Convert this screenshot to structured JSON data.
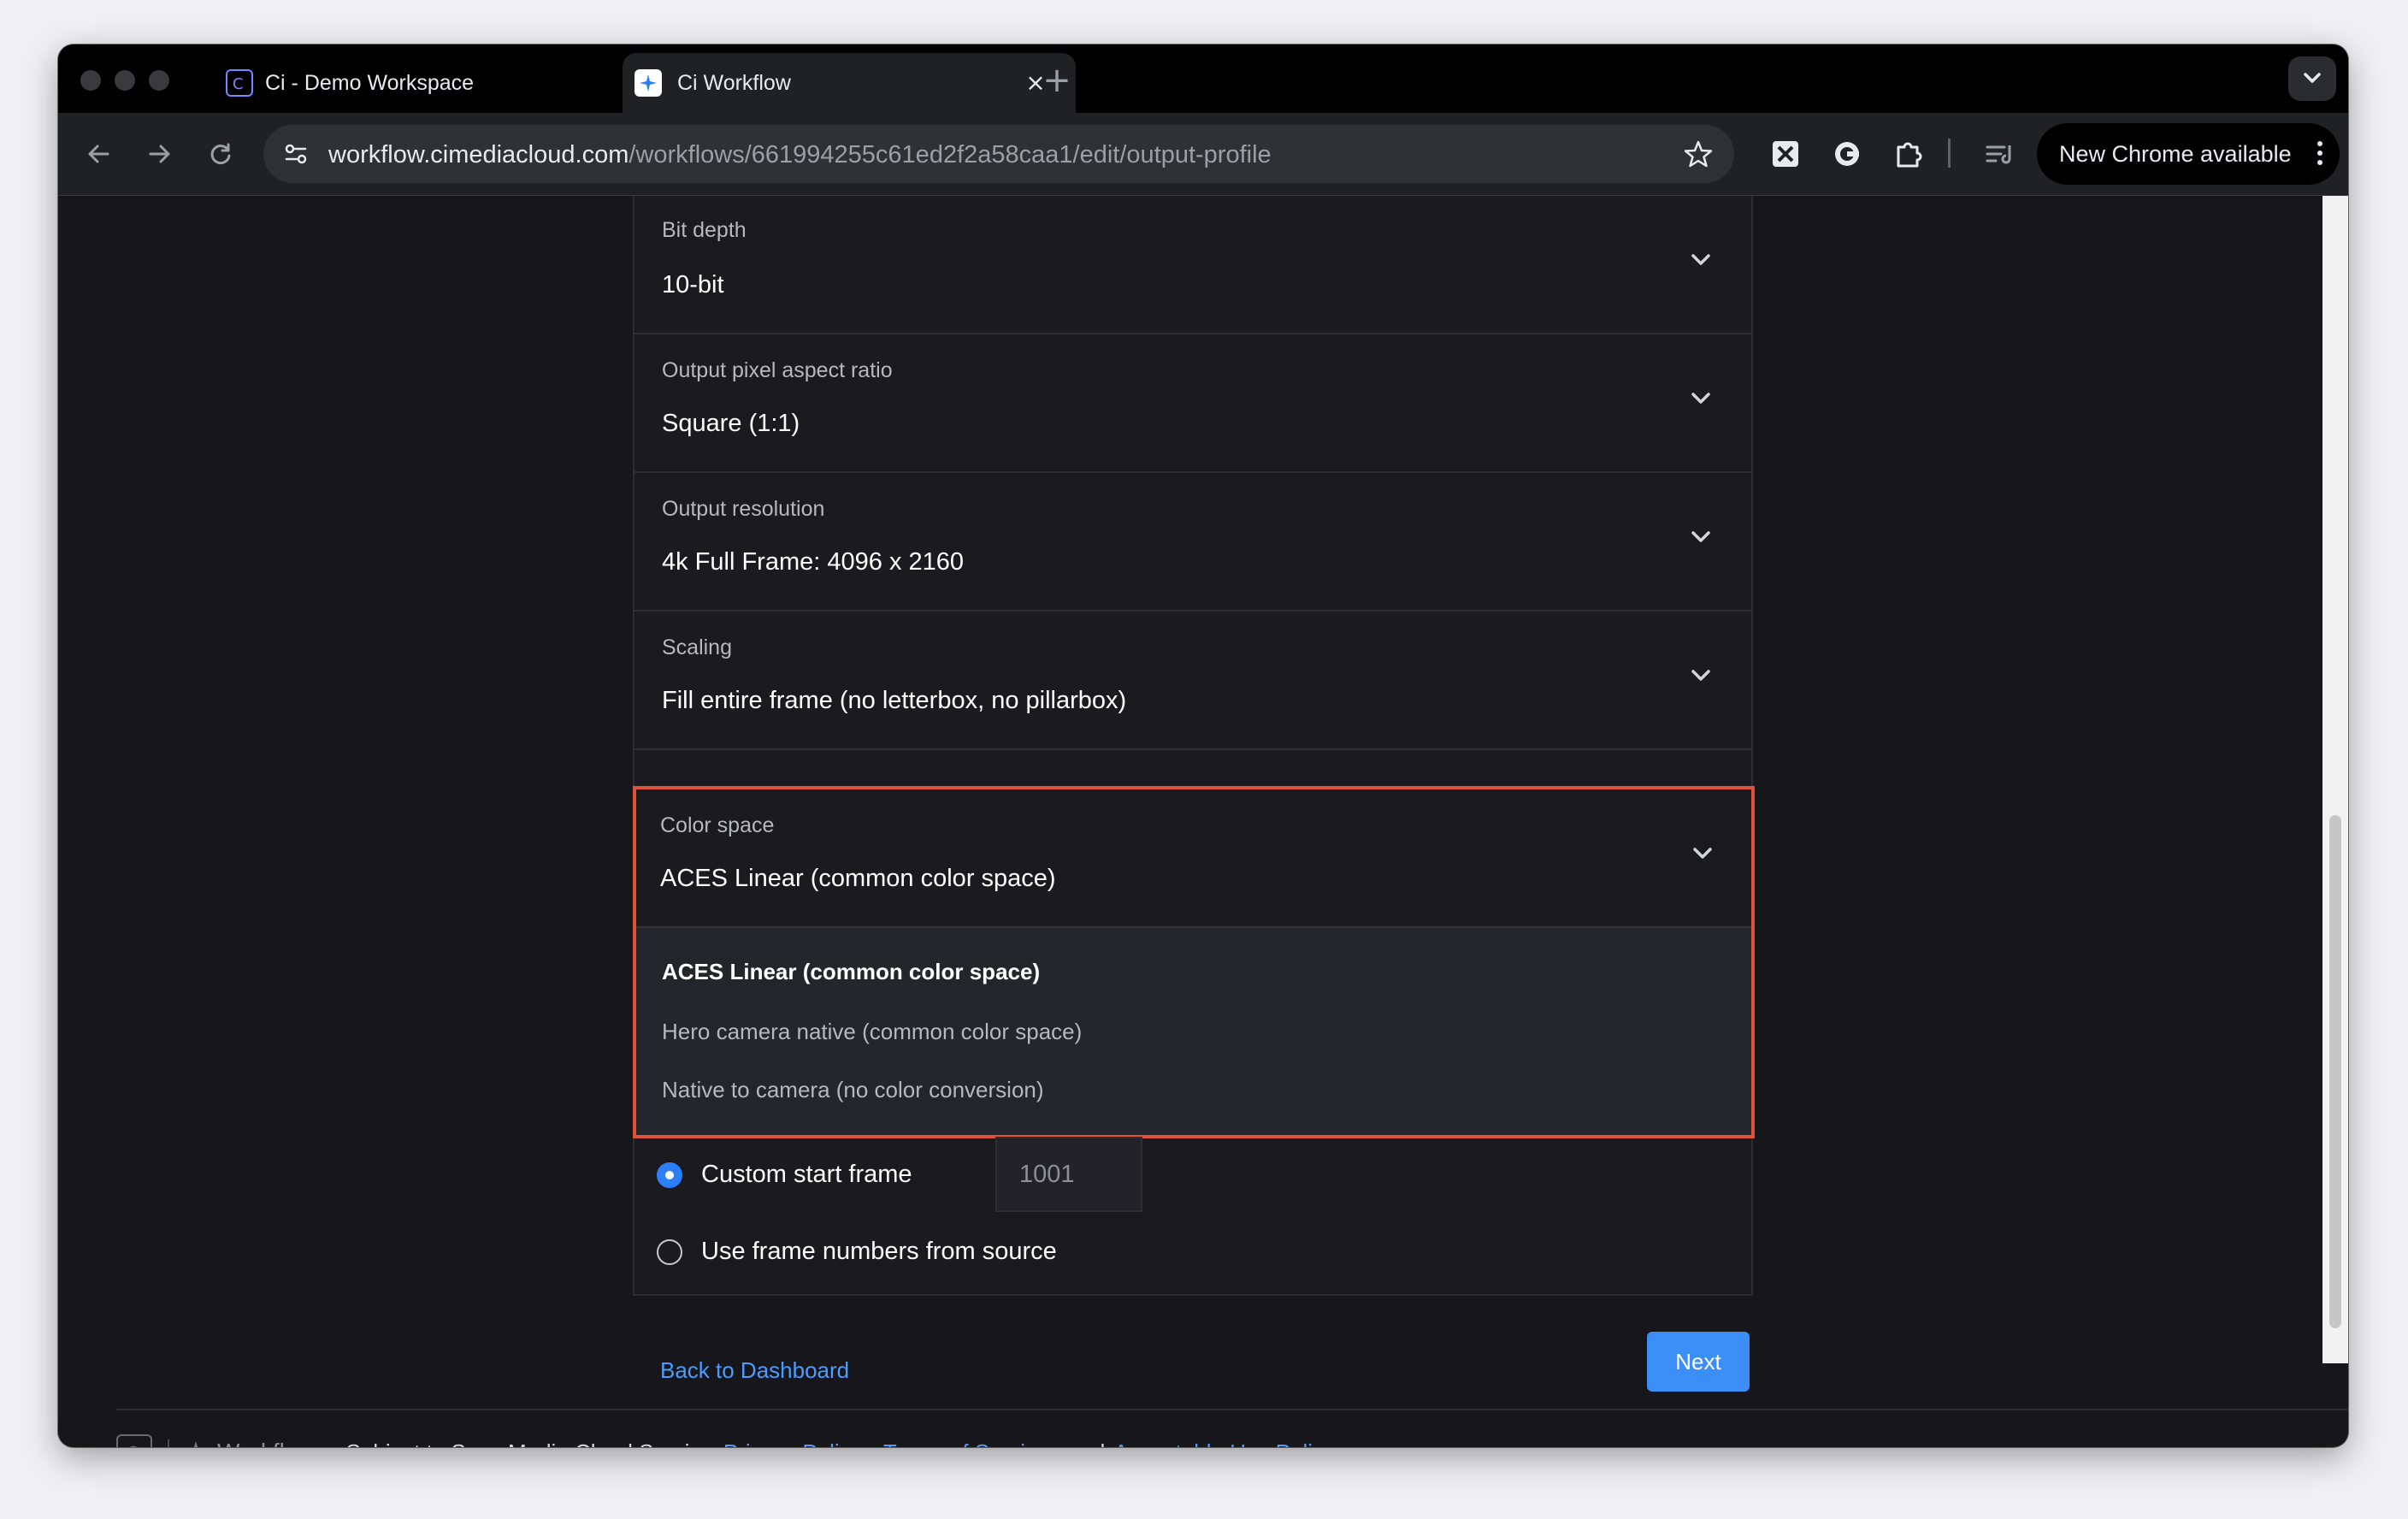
{
  "browser": {
    "tabs": [
      {
        "title": "Ci - Demo Workspace",
        "active": false
      },
      {
        "title": "Ci Workflow",
        "active": true
      }
    ],
    "url_host": "workflow.cimediacloud.com",
    "url_path": "/workflows/661994255c61ed2f2a58caa1/edit/output-profile",
    "update_label": "New Chrome available"
  },
  "form": {
    "fields": [
      {
        "label": "Bit depth",
        "value": "10-bit"
      },
      {
        "label": "Output pixel aspect ratio",
        "value": "Square (1:1)"
      },
      {
        "label": "Output resolution",
        "value": "4k Full Frame: 4096 x 2160"
      },
      {
        "label": "Scaling",
        "value": "Fill entire frame (no letterbox, no pillarbox)"
      }
    ],
    "color_space": {
      "label": "Color space",
      "value": "ACES Linear (common color space)",
      "options": [
        "ACES Linear (common color space)",
        "Hero camera native (common color space)",
        "Native to camera (no color conversion)"
      ]
    },
    "frame_numbering": {
      "custom_label": "Custom start frame",
      "custom_value": "1001",
      "source_label": "Use frame numbers from source",
      "selected": "custom"
    }
  },
  "actions": {
    "back_label": "Back to Dashboard",
    "next_label": "Next"
  },
  "footer": {
    "app_name": "Workflow",
    "prefix": "Subject to Sony Media Cloud Service",
    "privacy": "Privacy Policy",
    "sep1": ",",
    "terms": "Terms of Service",
    "sep2": ", and",
    "aup": "Acceptable Use Policy",
    "end": "."
  },
  "colors": {
    "accent": "#3a8ef6",
    "link": "#4d9bff",
    "highlight": "#e0523a",
    "page_bg": "#17171b"
  }
}
